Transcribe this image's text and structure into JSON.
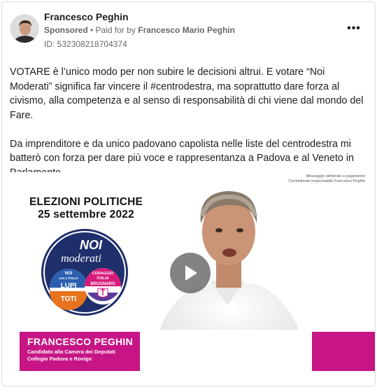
{
  "ad": {
    "advertiser_name": "Francesco Peghin",
    "sponsored_label": "Sponsored",
    "separator": " • ",
    "paid_for_prefix": "Paid for by ",
    "payer_name": "Francesco Mario Peghin",
    "ad_id": "ID: 532308218704374",
    "more_icon": "more-horizontal-icon",
    "more_symbol": "•••"
  },
  "body": {
    "paragraph_1": "VOTARE è l’unico modo per non subire le decisioni altrui. E votare “Noi Moderati” significa far vincere il #centrodestra, ma soprattutto dare forza al civismo, alla competenza e al senso di responsabilità di chi viene dal mondo del Fare.",
    "paragraph_2": "Da imprenditore e da unico padovano capolista nelle liste del centrodestra mi batterò con forza per dare più voce e rappresentanza a Padova e al Veneto in Parlamento…."
  },
  "media": {
    "disclaimer_line_1": "Messaggio elettorale a pagamento",
    "disclaimer_line_2": "Committente responsabile Francesco Peghin",
    "title_line_1": "ELEZIONI POLITICHE",
    "title_line_2": "25 settembre 2022",
    "logo": {
      "top_text_1": "NOI",
      "top_text_2": "moderati",
      "left_small_1": "NOI",
      "left_small_2": "con L'ITALIA",
      "left_lupi": "LUPI",
      "left_toti": "TOTI",
      "right_small_1": "CORAGGIO",
      "right_small_2": "ITALIA",
      "right_brugnaro": "BRUGNARO"
    },
    "candidate_name": "FRANCESCO PEGHIN",
    "candidate_role_1": "Candidato alla Camera dei Deputati",
    "candidate_role_2": "Collegio Padova e Rovigo",
    "play_icon": "play-icon"
  },
  "colors": {
    "accent_magenta": "#c71585",
    "logo_navy": "#1f2f6b",
    "logo_blue": "#2b5fb0",
    "logo_orange": "#e8731e",
    "logo_pink": "#d81b7a"
  }
}
